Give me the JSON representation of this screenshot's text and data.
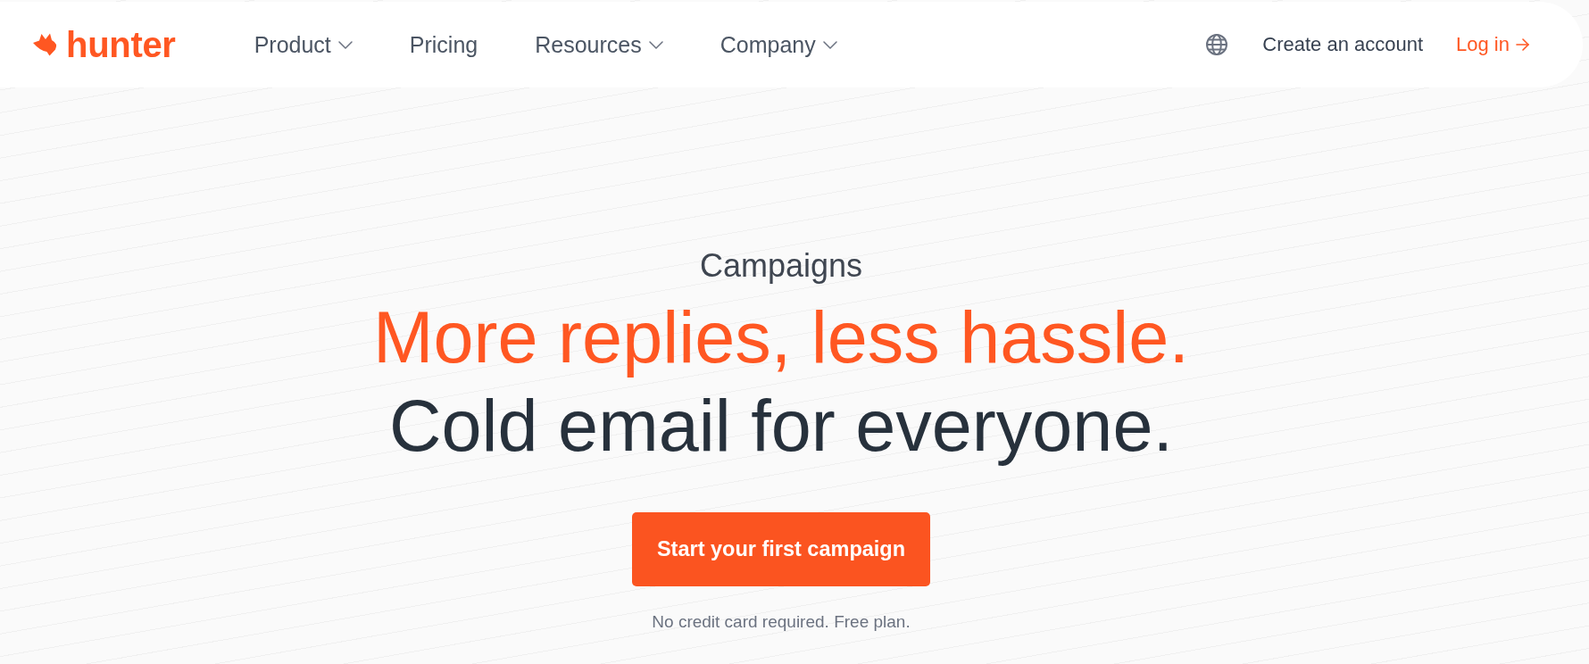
{
  "header": {
    "logo": {
      "text": "hunter"
    },
    "nav": [
      {
        "label": "Product",
        "dropdown": true
      },
      {
        "label": "Pricing",
        "dropdown": false
      },
      {
        "label": "Resources",
        "dropdown": true
      },
      {
        "label": "Company",
        "dropdown": true
      }
    ],
    "actions": {
      "create_account": "Create an account",
      "login": "Log in"
    }
  },
  "hero": {
    "eyebrow": "Campaigns",
    "headline": "More replies, less hassle.",
    "subheadline": "Cold email for everyone.",
    "cta": "Start your first campaign",
    "note": "No credit card required. Free plan."
  }
}
